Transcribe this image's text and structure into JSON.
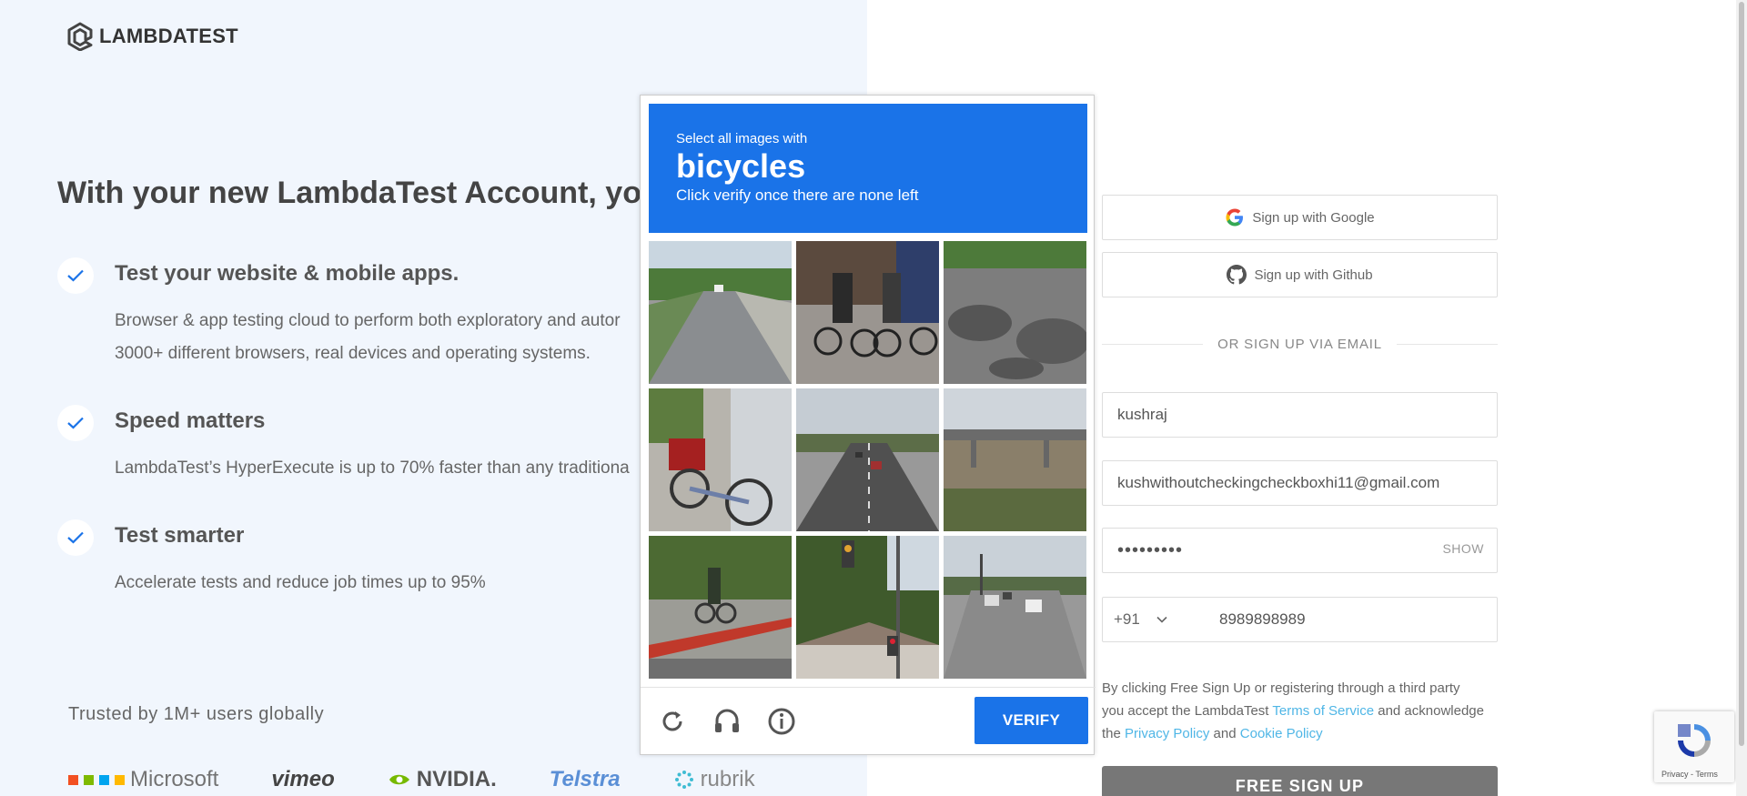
{
  "brand": {
    "logo_text": "LAMBDATEST"
  },
  "left": {
    "headline": "With your new LambdaTest Account, you get",
    "features": [
      {
        "title": "Test your website & mobile apps.",
        "desc_lines": [
          "Browser & app testing cloud to perform both exploratory and autor",
          "3000+ different browsers, real devices and operating systems."
        ]
      },
      {
        "title": "Speed matters",
        "desc_lines": [
          "LambdaTest’s HyperExecute is up to 70% faster than any traditiona"
        ]
      },
      {
        "title": "Test smarter",
        "desc_lines": [
          "Accelerate tests and reduce job times up to 95%"
        ]
      }
    ],
    "trusted": "Trusted by 1M+ users globally",
    "logos": [
      "Microsoft",
      "vimeo",
      "NVIDIA.",
      "Telstra",
      "rubrik"
    ]
  },
  "signup": {
    "google_label": "Sign up with Google",
    "github_label": "Sign up with Github",
    "divider": "OR SIGN UP VIA EMAIL",
    "name_value": "kushraj",
    "email_value": "kushwithoutcheckingcheckboxhi11@gmail.com",
    "password_value": "•••••••••",
    "show_label": "SHOW",
    "phone_code": "+91",
    "phone_value": "8989898989",
    "terms": {
      "part1": "By clicking Free Sign Up or registering through a third party you accept the LambdaTest ",
      "tos": "Terms of Service",
      "part2": " and acknowledge the ",
      "privacy": "Privacy Policy",
      "and": " and ",
      "cookie": "Cookie Policy"
    },
    "submit_label": "FREE SIGN UP"
  },
  "recaptcha_badge": {
    "label": "Privacy - Terms"
  },
  "captcha": {
    "instruction_small": "Select all images with",
    "target": "bicycles",
    "instruction_sub": "Click verify once there are none left",
    "verify_label": "VERIFY",
    "tiles": [
      "street-road",
      "people-with-bicycles",
      "shaded-road",
      "bicycle-with-basket",
      "highway-cars",
      "overpass-field",
      "cyclist-sidewalk",
      "traffic-light-house",
      "multi-lane-road"
    ]
  },
  "colors": {
    "captcha_blue": "#1a73e8",
    "link": "#4fb6e6",
    "left_bg": "#f1f6fd",
    "check": "#1a73e8"
  }
}
